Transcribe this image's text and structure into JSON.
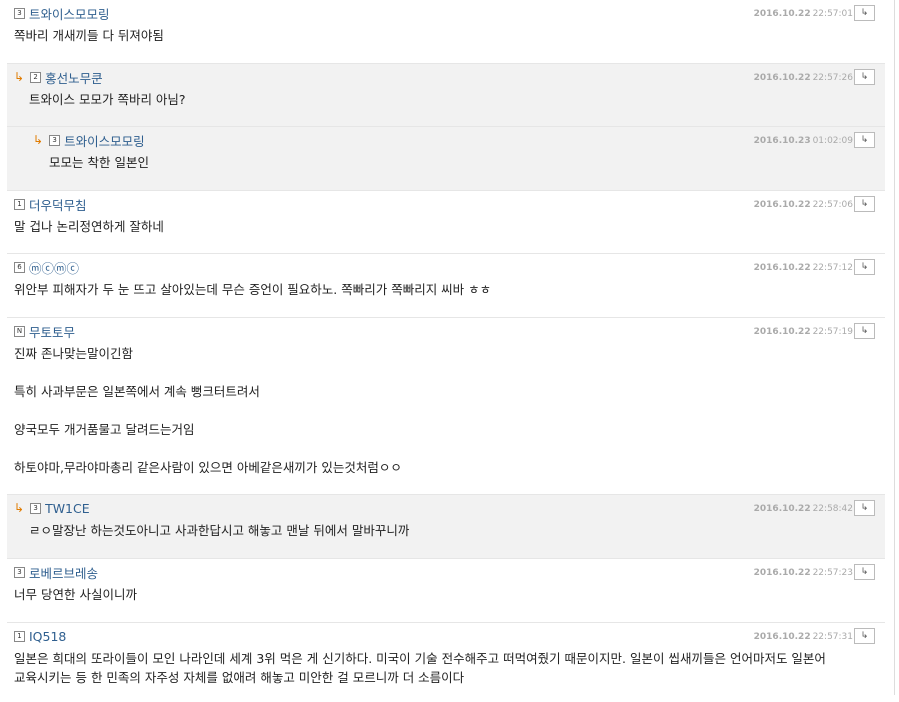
{
  "comments": [
    {
      "reply": false,
      "level": "3",
      "nick": "트와이스모모링",
      "date": "2016.10.22",
      "time": "22:57:01",
      "lines": [
        "쪽바리 개새끼들 다 뒤져야됨"
      ]
    },
    {
      "reply": true,
      "depth": 1,
      "level": "2",
      "nick": "홍선노무쿤",
      "date": "2016.10.22",
      "time": "22:57:26",
      "lines": [
        "트와이스 모모가 쪽바리 아님?"
      ]
    },
    {
      "reply": true,
      "depth": 2,
      "level": "3",
      "nick": "트와이스모모링",
      "date": "2016.10.23",
      "time": "01:02:09",
      "lines": [
        "모모는 착한 일본인"
      ]
    },
    {
      "reply": false,
      "level": "1",
      "nick": "더우덕무침",
      "date": "2016.10.22",
      "time": "22:57:06",
      "lines": [
        "말 겁나 논리정연하게 잘하네"
      ]
    },
    {
      "reply": false,
      "level": "6",
      "nick": "ⓜⓒⓜⓒ",
      "date": "2016.10.22",
      "time": "22:57:12",
      "lines": [
        "위안부 피해자가 두 눈 뜨고 살아있는데 무슨 증언이 필요하노. 쪽빠리가 쪽빠리지 씨바 ㅎㅎ"
      ]
    },
    {
      "reply": false,
      "level": "N",
      "nick": "무토토무",
      "date": "2016.10.22",
      "time": "22:57:19",
      "lines": [
        "진짜 존나맞는말이긴함",
        "",
        "특히 사과부문은 일본쪽에서 계속 뻥크터트려서",
        "",
        "양국모두 개거품물고 달려드는거임",
        "",
        "하토야마,무라야마총리 같은사람이 있으면 아베같은새끼가 있는것처럼ㅇㅇ"
      ]
    },
    {
      "reply": true,
      "depth": 1,
      "level": "3",
      "nick": "TW1CE",
      "date": "2016.10.22",
      "time": "22:58:42",
      "lines": [
        "ㄹㅇ말장난 하는것도아니고 사과한답시고 해놓고 맨날 뒤에서 말바꾸니까"
      ]
    },
    {
      "reply": false,
      "level": "3",
      "nick": "로베르브레송",
      "date": "2016.10.22",
      "time": "22:57:23",
      "lines": [
        "너무 당연한 사실이니까"
      ]
    },
    {
      "reply": false,
      "level": "1",
      "nick": "IQ518",
      "date": "2016.10.22",
      "time": "22:57:31",
      "lines": [
        "일본은 희대의 또라이들이 모인 나라인데 세계 3위 먹은 게 신기하다. 미국이 기술 전수해주고 떠먹여줬기 때문이지만. 일본이 씹새끼들은 언어마저도 일본어",
        "교육시키는 등 한 민족의 자주성 자체를 없애려 해놓고 미안한 걸 모르니까 더 소름이다"
      ]
    }
  ],
  "ui": {
    "reply_arrow": "↳",
    "reply_button": "↳"
  }
}
